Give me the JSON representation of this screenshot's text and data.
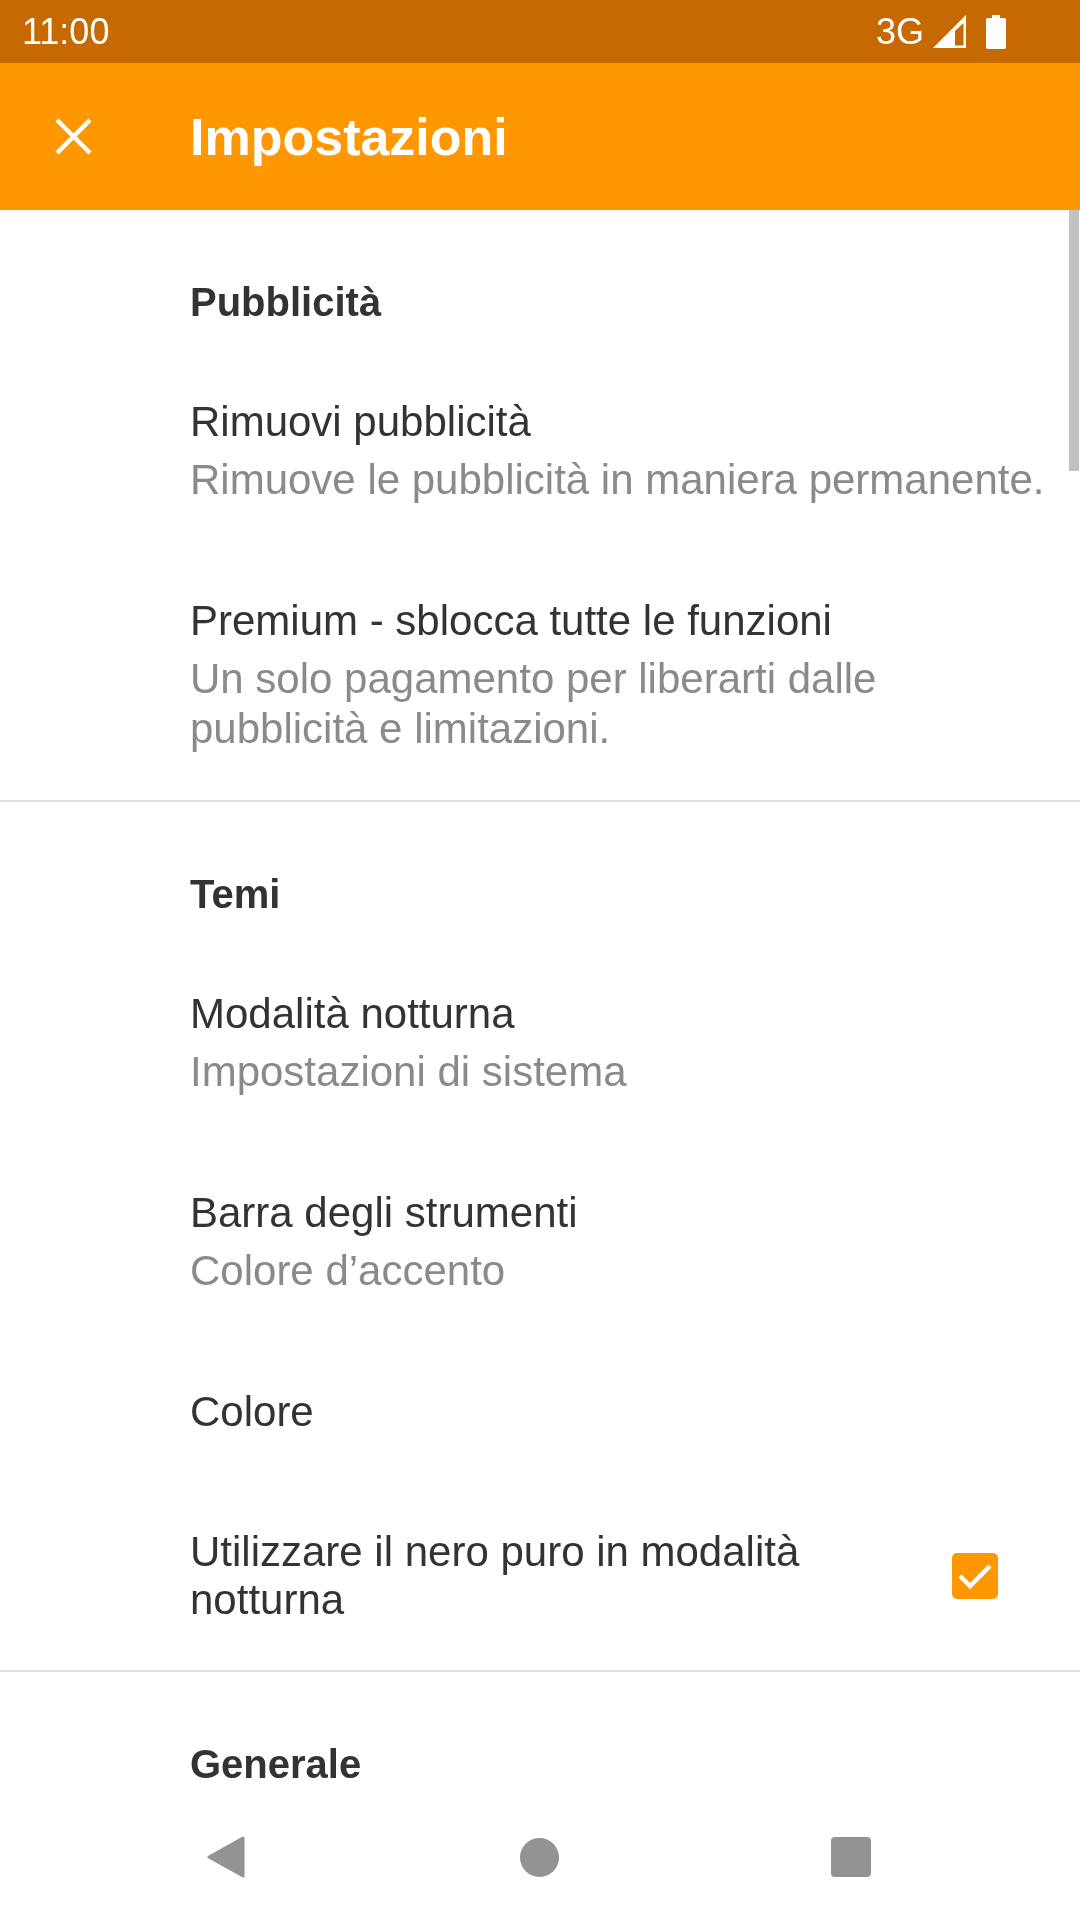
{
  "status_bar": {
    "time": "11:00",
    "network": "3G"
  },
  "toolbar": {
    "title": "Impostazioni"
  },
  "sections": [
    {
      "title": "Pubblicità",
      "items": [
        {
          "kind": "plain",
          "title": "Rimuovi pubblicità",
          "summary": "Rimuove le pubblicità in maniera permanente."
        },
        {
          "kind": "plain",
          "title": "Premium - sblocca tutte le funzioni",
          "summary": "Un solo pagamento per liberarti dalle pubblicità e limitazioni."
        }
      ]
    },
    {
      "title": "Temi",
      "items": [
        {
          "kind": "plain",
          "title": "Modalità notturna",
          "summary": "Impostazioni di sistema"
        },
        {
          "kind": "plain",
          "title": "Barra degli strumenti",
          "summary": "Colore d’accento"
        },
        {
          "kind": "plain",
          "title": "Colore"
        },
        {
          "kind": "checkbox",
          "title": "Utilizzare il nero puro in modalità notturna",
          "checked": true
        }
      ]
    },
    {
      "title": "Generale"
    }
  ]
}
